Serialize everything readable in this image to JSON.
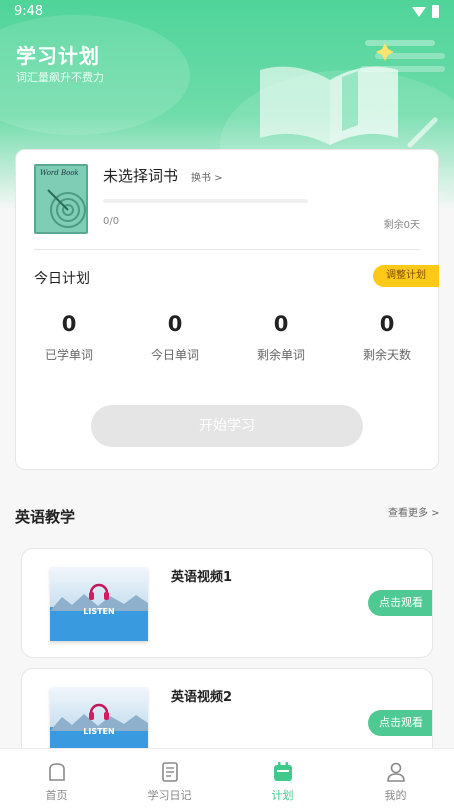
{
  "status_bar": {
    "time": "9:48"
  },
  "header": {
    "title": "学习计划",
    "subtitle": "词汇量飙升不费力"
  },
  "book": {
    "cover_text": "Word Book",
    "name": "未选择词书",
    "change_label": "换书 >",
    "progress_text": "0/0",
    "progress_fraction": 0,
    "remaining_days": "剩余0天"
  },
  "today_plan": {
    "title": "今日计划",
    "adjust_label": "调整计划",
    "stats": [
      {
        "value": "0",
        "label": "已学单词"
      },
      {
        "value": "0",
        "label": "今日单词"
      },
      {
        "value": "0",
        "label": "剩余单词"
      },
      {
        "value": "0",
        "label": "剩余天数"
      }
    ],
    "start_label": "开始学习"
  },
  "teaching": {
    "title": "英语教学",
    "more_label": "查看更多 >",
    "videos": [
      {
        "thumb_text": "LISTEN",
        "title": "英语视频1",
        "watch_label": "点击观看"
      },
      {
        "thumb_text": "LISTEN",
        "title": "英语视频2",
        "watch_label": "点击观看"
      }
    ]
  },
  "tabbar": {
    "tabs": [
      {
        "label": "首页",
        "icon": "home-icon"
      },
      {
        "label": "学习日记",
        "icon": "notebook-icon"
      },
      {
        "label": "计划",
        "icon": "calendar-icon"
      },
      {
        "label": "我的",
        "icon": "person-icon"
      }
    ],
    "active_index": 2
  },
  "colors": {
    "accent": "#4fd49a",
    "adjust": "#ffc917",
    "watch": "#4fc994"
  }
}
